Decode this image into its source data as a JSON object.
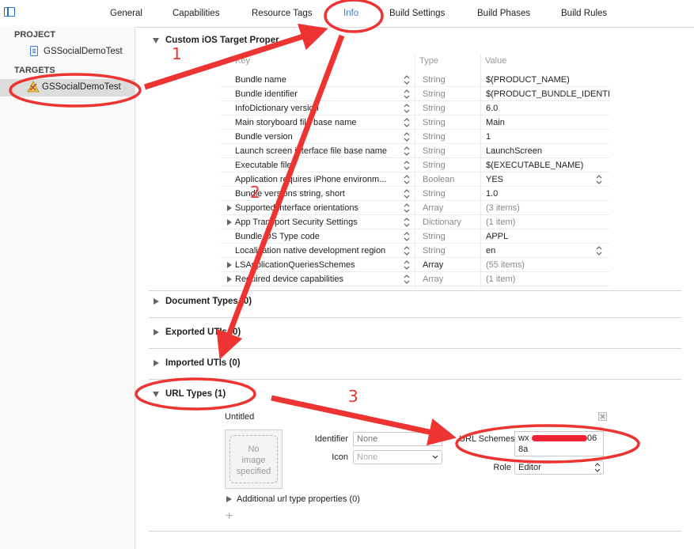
{
  "tabs": {
    "general": "General",
    "capabilities": "Capabilities",
    "resource_tags": "Resource Tags",
    "info": "Info",
    "build_settings": "Build Settings",
    "build_phases": "Build Phases",
    "build_rules": "Build Rules",
    "active_tab": "Info"
  },
  "sidebar": {
    "project_header": "PROJECT",
    "project_item": "GSSocialDemoTest",
    "targets_header": "TARGETS",
    "target_item": "GSSocialDemoTest"
  },
  "custom_properties": {
    "title": "Custom iOS Target Proper",
    "col_key": "Key",
    "col_type": "Type",
    "col_value": "Value",
    "rows": [
      {
        "key": "Bundle name",
        "type": "String",
        "value": "$(PRODUCT_NAME)"
      },
      {
        "key": "Bundle identifier",
        "type": "String",
        "value": "$(PRODUCT_BUNDLE_IDENTI"
      },
      {
        "key": "InfoDictionary version",
        "type": "String",
        "value": "6.0"
      },
      {
        "key": "Main storyboard file base name",
        "type": "String",
        "value": "Main"
      },
      {
        "key": "Bundle version",
        "type": "String",
        "value": "1"
      },
      {
        "key": "Launch screen interface file base name",
        "type": "String",
        "value": "LaunchScreen"
      },
      {
        "key": "Executable file",
        "type": "String",
        "value": "$(EXECUTABLE_NAME)"
      },
      {
        "key": "Application requires iPhone environm...",
        "type": "Boolean",
        "value": "YES"
      },
      {
        "key": "Bundle versions string, short",
        "type": "String",
        "value": "1.0"
      },
      {
        "key": "Supported interface orientations",
        "type": "Array",
        "value": "(3 items)"
      },
      {
        "key": "App Transport Security Settings",
        "type": "Dictionary",
        "value": "(1 item)"
      },
      {
        "key": "Bundle OS Type code",
        "type": "String",
        "value": "APPL"
      },
      {
        "key": "Localization native development region",
        "type": "String",
        "value": "en"
      },
      {
        "key": "LSApplicationQueriesSchemes",
        "type": "Array",
        "value": "(55 items)"
      },
      {
        "key": "Required device capabilities",
        "type": "Array",
        "value": "(1 item)"
      }
    ]
  },
  "sections": {
    "document_types": "Document Types (0)",
    "exported_utis": "Exported UTIs (0)",
    "imported_utis": "Imported UTIs (0)",
    "url_types": "URL Types (1)"
  },
  "url_type": {
    "name": "Untitled",
    "no_image": "No\nimage\nspecified",
    "identifier_label": "Identifier",
    "identifier_placeholder": "None",
    "icon_label": "Icon",
    "icon_placeholder": "None",
    "url_schemes_label": "URL Schemes",
    "url_schemes_value_line1": "wx",
    "url_schemes_value_tail1": "06",
    "url_schemes_value_line2": "8a",
    "role_label": "Role",
    "role_value": "Editor",
    "additional_props": "Additional url type properties (0)",
    "add_symbol": "+"
  },
  "annotations": {
    "num1": "1",
    "num2": "2",
    "num3": "3",
    "color": "#ee3333"
  }
}
